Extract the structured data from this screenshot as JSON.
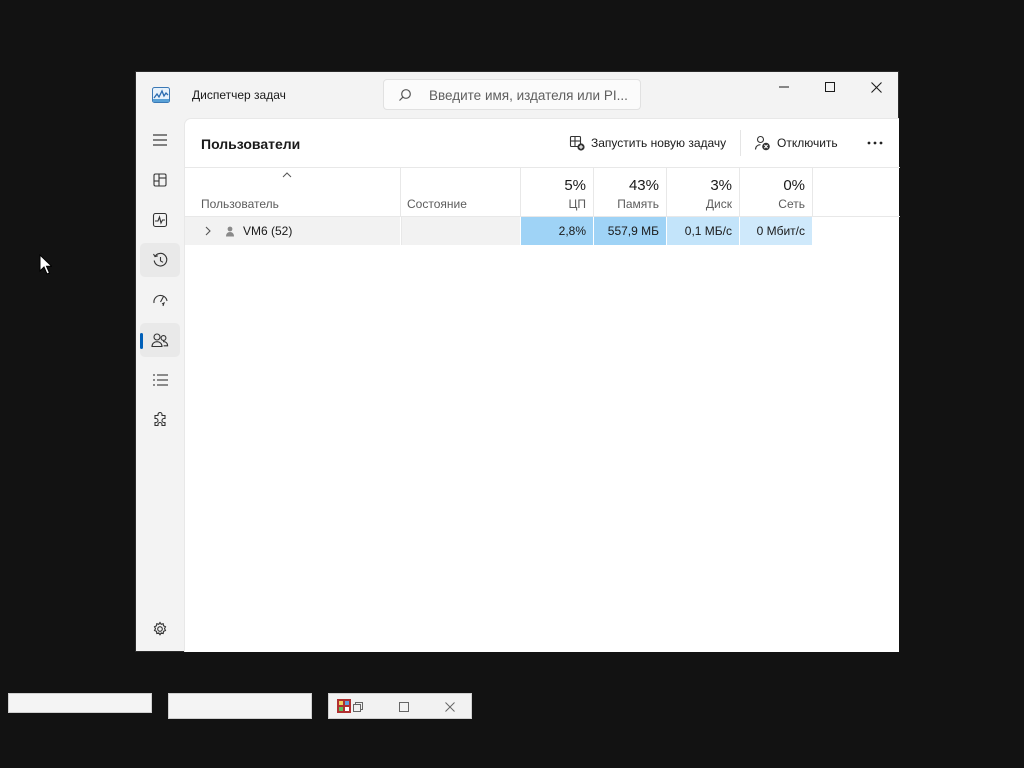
{
  "window": {
    "title": "Диспетчер задач",
    "search_placeholder": "Введите имя, издателя или PI..."
  },
  "nav": {
    "items": [
      {
        "name": "hamburger-menu",
        "icon": "menu-icon"
      },
      {
        "name": "processes",
        "icon": "processes-icon"
      },
      {
        "name": "performance",
        "icon": "performance-icon"
      },
      {
        "name": "app-history",
        "icon": "history-icon"
      },
      {
        "name": "startup-apps",
        "icon": "speedometer-icon"
      },
      {
        "name": "users",
        "icon": "users-icon",
        "active": true
      },
      {
        "name": "details",
        "icon": "list-icon"
      },
      {
        "name": "services",
        "icon": "puzzle-icon"
      },
      {
        "name": "settings",
        "icon": "gear-icon"
      }
    ]
  },
  "page": {
    "title": "Пользователи",
    "run_new_task": "Запустить новую задачу",
    "disconnect": "Отключить"
  },
  "columns": {
    "user": "Пользователь",
    "state": "Состояние",
    "cpu": {
      "pct": "5%",
      "label": "ЦП"
    },
    "memory": {
      "pct": "43%",
      "label": "Память"
    },
    "disk": {
      "pct": "3%",
      "label": "Диск"
    },
    "network": {
      "pct": "0%",
      "label": "Сеть"
    }
  },
  "rows": [
    {
      "user": "VM6 (52)",
      "state": "",
      "cpu": "2,8%",
      "memory": "557,9 МБ",
      "disk": "0,1 МБ/с",
      "network": "0 Мбит/с"
    }
  ],
  "colors": {
    "accent": "#005fb8",
    "cpu_heat": "#9fd3f6",
    "memory_heat": "#9fd3f6",
    "disk_heat": "#c3e4fa",
    "network_heat": "#cfe9fb"
  }
}
